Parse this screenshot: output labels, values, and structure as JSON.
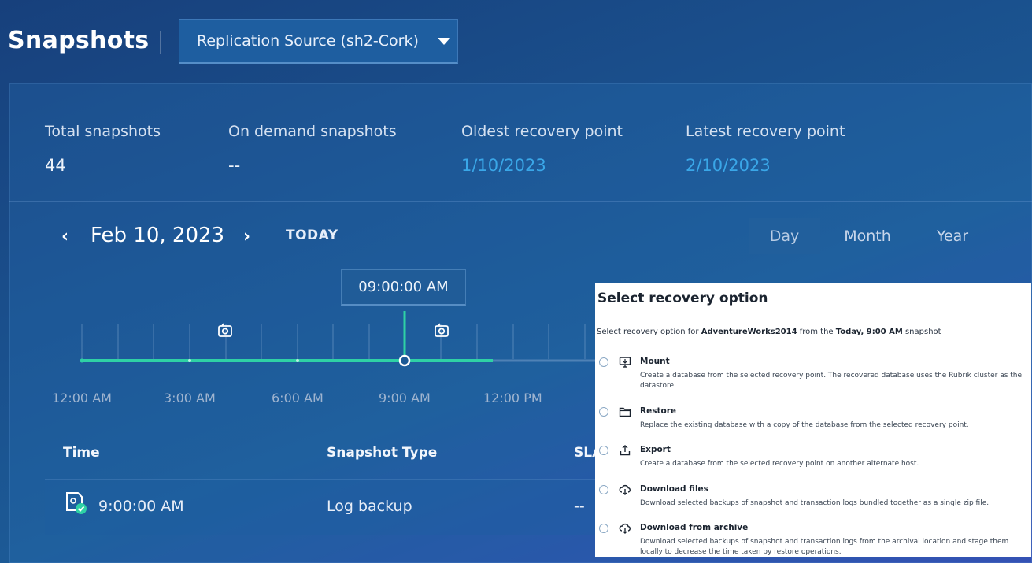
{
  "header": {
    "title": "Snapshots",
    "source_selector": "Replication Source (sh2-Cork)"
  },
  "stats": [
    {
      "label": "Total snapshots",
      "value": "44"
    },
    {
      "label": "On demand snapshots",
      "value": "--"
    },
    {
      "label": "Oldest recovery point",
      "value": "1/10/2023"
    },
    {
      "label": "Latest recovery point",
      "value": "2/10/2023"
    }
  ],
  "date_nav": {
    "prev": "‹",
    "date": "Feb 10, 2023",
    "next": "›",
    "today": "TODAY",
    "ranges": [
      "Day",
      "Month",
      "Year"
    ],
    "active_range": "Day"
  },
  "timeline": {
    "selected_time": "09:00:00 AM",
    "ticks": [
      "12:00 AM",
      "3:00 AM",
      "6:00 AM",
      "9:00 AM",
      "12:00 PM"
    ]
  },
  "table": {
    "headers": [
      "Time",
      "Snapshot Type",
      "SLA"
    ],
    "rows": [
      {
        "time": "9:00:00 AM",
        "type": "Log backup",
        "sla": "--"
      }
    ]
  },
  "recovery_modal": {
    "title": "Select recovery option",
    "subtitle_prefix": "Select recovery option for ",
    "database": "AdventureWorks2014",
    "subtitle_middle": " from the ",
    "snapshot": "Today, 9:00 AM",
    "subtitle_suffix": " snapshot",
    "options": [
      {
        "icon": "monitor-icon",
        "name": "Mount",
        "desc": "Create a database from the selected recovery point. The recovered database uses the Rubrik cluster as the datastore."
      },
      {
        "icon": "folder-icon",
        "name": "Restore",
        "desc": "Replace the existing database with a copy of the database from the selected recovery point."
      },
      {
        "icon": "export-icon",
        "name": "Export",
        "desc": "Create a database from the selected recovery point on another alternate host."
      },
      {
        "icon": "cloud-download-icon",
        "name": "Download files",
        "desc": "Download selected backups of snapshot and transaction logs bundled together as a single zip file."
      },
      {
        "icon": "cloud-download-icon",
        "name": "Download from archive",
        "desc": "Download selected backups of snapshot and transaction logs from the archival location and stage them locally to decrease the time taken by restore operations."
      }
    ]
  },
  "colors": {
    "accent_green": "#2fd1a5",
    "link_blue": "#3aa7e8"
  }
}
